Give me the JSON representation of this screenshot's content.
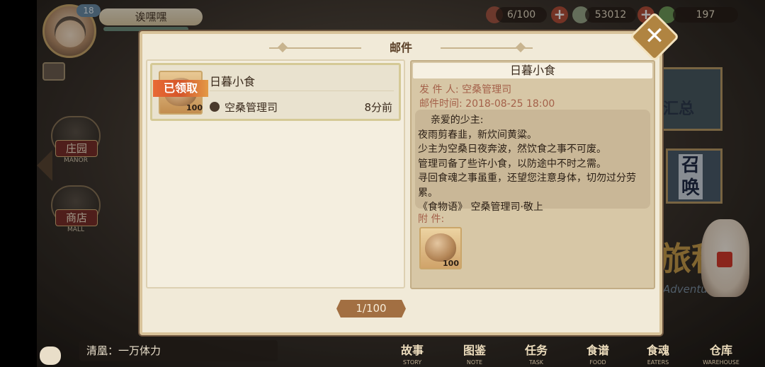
{
  "hud": {
    "level": "18",
    "player_name": "诶嘿嘿",
    "stamina": "6/100",
    "coins": "53012",
    "gems": "197"
  },
  "side_nav": {
    "manor_label": "庄园",
    "manor_sub": "MANOR",
    "mall_label": "商店",
    "mall_sub": "MALL"
  },
  "background": {
    "summary_text": "汇总",
    "summon_text": "召唤",
    "adventure_text": "旅程",
    "adventure_sub": "Adventure"
  },
  "chat": {
    "message": "清凰：一万体力"
  },
  "bottom_nav": [
    {
      "label": "故事",
      "sub": "STORY"
    },
    {
      "label": "图鉴",
      "sub": "NOTE"
    },
    {
      "label": "任务",
      "sub": "TASK"
    },
    {
      "label": "食谱",
      "sub": "FOOD"
    },
    {
      "label": "食魂",
      "sub": "EATERS"
    },
    {
      "label": "仓库",
      "sub": "WAREHOUSE"
    }
  ],
  "dialog": {
    "title": "邮件",
    "close_icon": "close-icon",
    "pager": "1/100"
  },
  "mail_list": [
    {
      "status": "已领取",
      "subject": "日暮小食",
      "sender": "空桑管理司",
      "time": "8分前",
      "quantity": "100"
    }
  ],
  "detail": {
    "title": "日暮小食",
    "sender_line": "发 件 人: 空桑管理司",
    "time_line": "邮件时间: 2018-08-25 18:00",
    "body": "    亲爱的少主:\n夜雨剪春韭，新炊间黄粱。\n少主为空桑日夜奔波，然饮食之事不可废。\n管理司备了些许小食，以防途中不时之需。\n寻回食魂之事虽重，还望您注意身体，切勿过分劳累。\n《食物语》 空桑管理司·敬上",
    "attach_label": "附      件:",
    "attach_quantity": "100"
  }
}
